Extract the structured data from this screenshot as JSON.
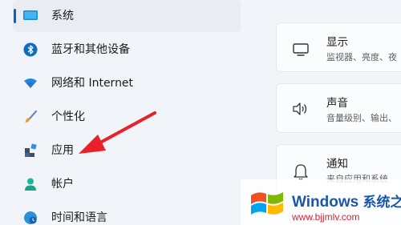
{
  "nav": {
    "items": [
      {
        "label": "系统",
        "icon": "display-icon",
        "selected": true
      },
      {
        "label": "蓝牙和其他设备",
        "icon": "bluetooth-icon"
      },
      {
        "label": "网络和 Internet",
        "icon": "wifi-icon"
      },
      {
        "label": "个性化",
        "icon": "brush-icon"
      },
      {
        "label": "应用",
        "icon": "apps-icon"
      },
      {
        "label": "帐户",
        "icon": "account-icon"
      },
      {
        "label": "时间和语言",
        "icon": "globe-clock-icon"
      }
    ]
  },
  "cards": [
    {
      "title": "显示",
      "subtitle": "监视器、亮度、夜",
      "icon": "monitor-icon"
    },
    {
      "title": "声音",
      "subtitle": "音量级别、输出、",
      "icon": "speaker-icon"
    },
    {
      "title": "通知",
      "subtitle": "来自应用和系统",
      "icon": "bell-icon"
    }
  ],
  "watermark": {
    "title": "Windows",
    "title_cn": "系统之家",
    "url": "www.bjjmlv.com"
  },
  "colors": {
    "accent": "#0067c0",
    "annotation_arrow": "#e8222a",
    "background": "#f1f4f9"
  }
}
